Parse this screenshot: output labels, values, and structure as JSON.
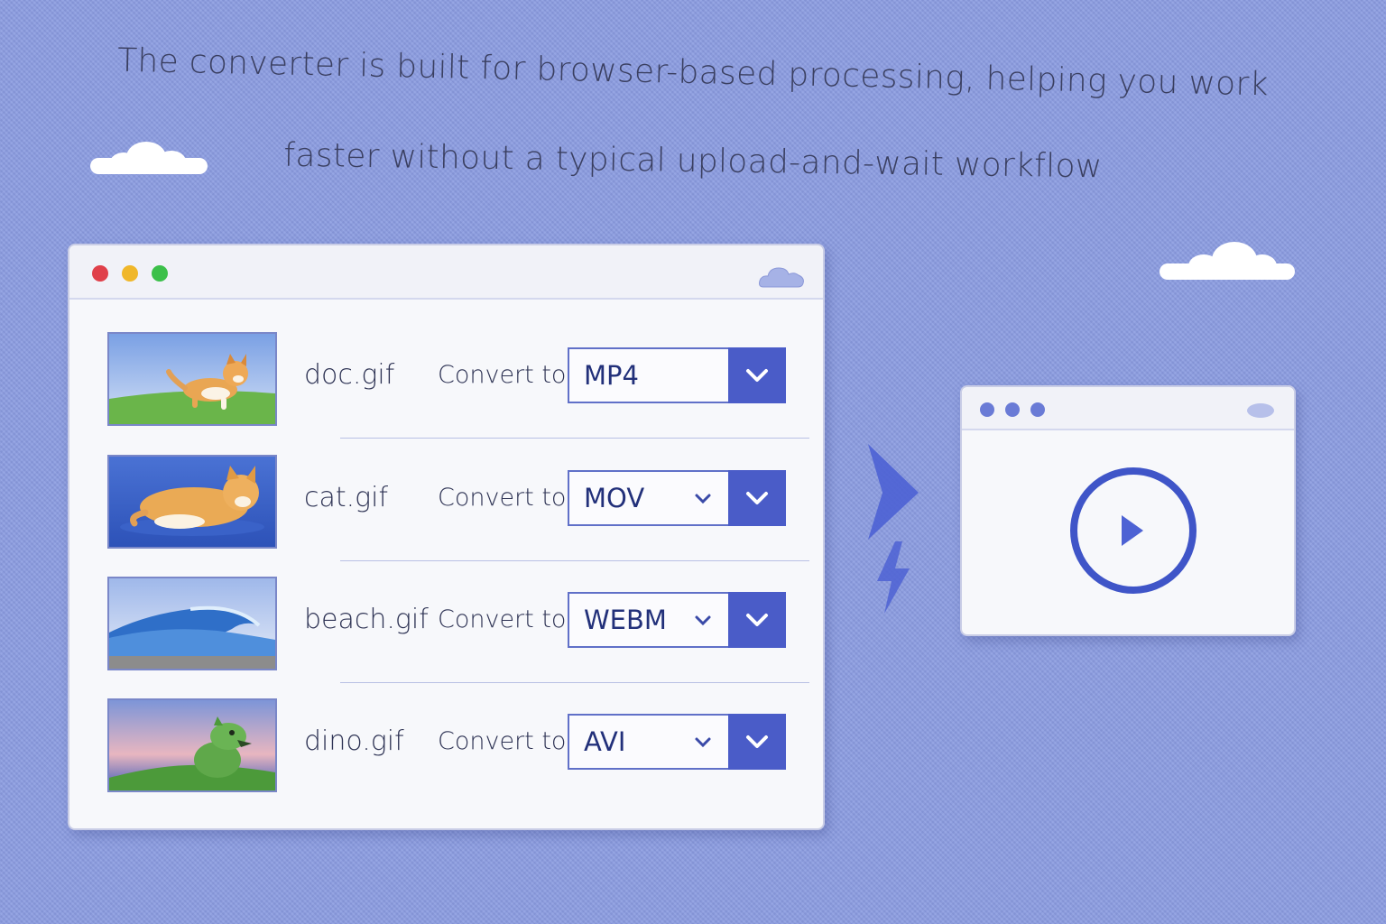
{
  "headline": {
    "line1": "The converter is built for browser-based processing, helping you work",
    "line2": "faster without a typical upload-and-wait workflow"
  },
  "converter_window": {
    "rows": [
      {
        "filename": "doc.gif",
        "convert_label": "Convert to",
        "format": "MP4",
        "thumbnail": "dog-on-grass"
      },
      {
        "filename": "cat.gif",
        "convert_label": "Convert to",
        "format": "MOV",
        "thumbnail": "cat-lying"
      },
      {
        "filename": "beach.gif",
        "convert_label": "Convert to",
        "format": "WEBM",
        "thumbnail": "ocean-wave"
      },
      {
        "filename": "dino.gif",
        "convert_label": "Convert to",
        "format": "AVI",
        "thumbnail": "green-dino"
      }
    ]
  },
  "icons": {
    "arrow": "arrow-right-icon",
    "bolt": "lightning-bolt-icon",
    "play": "play-icon",
    "dropdown": "chevron-down-icon",
    "cloud": "cloud-icon"
  },
  "colors": {
    "background": "#8a9be0",
    "accent": "#4a5cc8",
    "traffic_red": "#e0404a",
    "traffic_yellow": "#f0b72a",
    "traffic_green": "#3cc04a"
  }
}
